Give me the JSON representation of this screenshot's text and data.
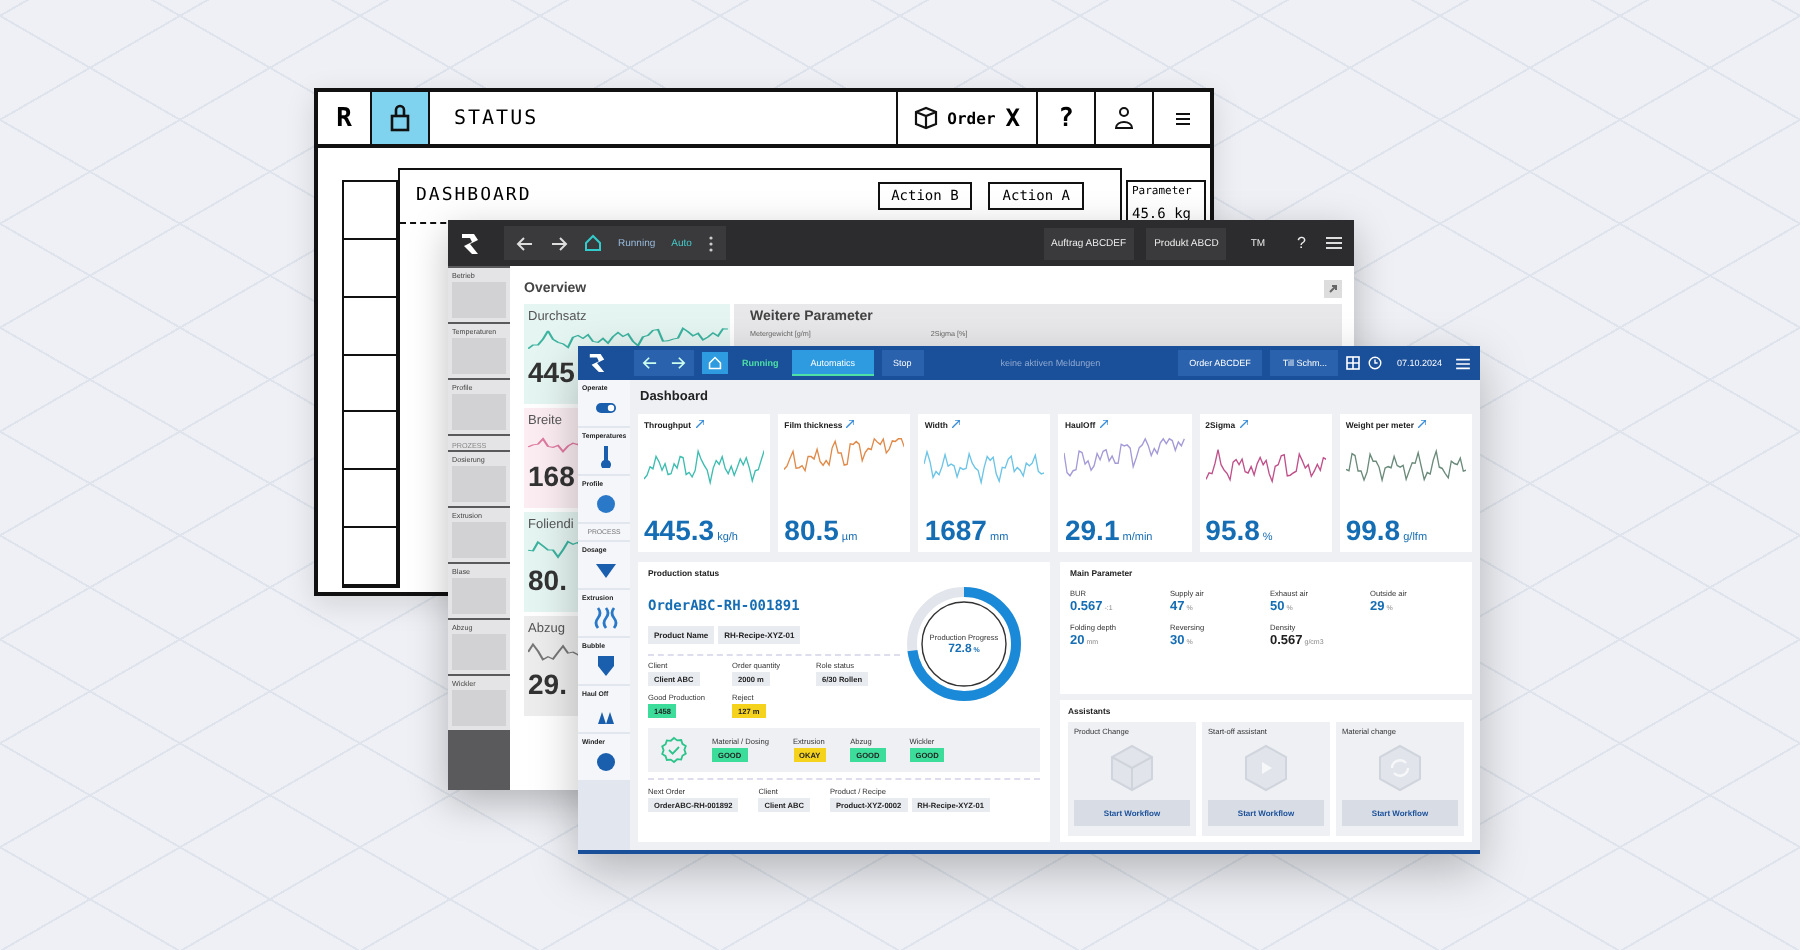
{
  "sketch": {
    "logo": "R",
    "title": "STATUS",
    "order": "Order",
    "close": "X",
    "help": "?",
    "section_title": "DASHBOARD",
    "actions": [
      "Action B",
      "Action A"
    ],
    "param_label": "Parameter",
    "param_value": "45.6 kg"
  },
  "dark": {
    "status": "Running",
    "mode": "Auto",
    "order": "Auftrag ABCDEF",
    "product": "Produkt ABCD",
    "user": "TM",
    "help": "?",
    "sidebar": [
      {
        "kind": "item",
        "label": "Betrieb"
      },
      {
        "kind": "item",
        "label": "Temperaturen"
      },
      {
        "kind": "item",
        "label": "Profile"
      },
      {
        "kind": "header",
        "label": "PROZESS"
      },
      {
        "kind": "item",
        "label": "Dosierung"
      },
      {
        "kind": "item",
        "label": "Extrusion"
      },
      {
        "kind": "item",
        "label": "Blase"
      },
      {
        "kind": "item",
        "label": "Abzug"
      },
      {
        "kind": "item",
        "label": "Wickler"
      }
    ],
    "title": "Overview",
    "cards": [
      {
        "label": "Durchsatz",
        "value": "445",
        "color": "#3cb4a0"
      },
      {
        "label": "Breite",
        "value": "168",
        "color": "#e07aa0"
      },
      {
        "label": "Foliendi",
        "value": "80.",
        "color": "#3cb4a0"
      },
      {
        "label": "Abzug",
        "value": "29.",
        "color": "#777777"
      }
    ],
    "panel_title": "Weitere Parameter",
    "panel_fields": [
      "Metergewicht [g/m]",
      "2Sigma [%]"
    ]
  },
  "front": {
    "status": "Running",
    "modes": [
      {
        "label": "Automatics",
        "selected": true
      },
      {
        "label": "Stop",
        "selected": false
      }
    ],
    "message": "keine aktiven Meldungen",
    "order": "Order ABCDEF",
    "user": "Till Schm...",
    "date": "07.10.2024",
    "sidebar": [
      {
        "kind": "item",
        "label": "Operate"
      },
      {
        "kind": "item",
        "label": "Temperatures"
      },
      {
        "kind": "item",
        "label": "Profile"
      },
      {
        "kind": "header",
        "label": "PROCESS"
      },
      {
        "kind": "item",
        "label": "Dosage"
      },
      {
        "kind": "item",
        "label": "Extrusion"
      },
      {
        "kind": "item",
        "label": "Bubble"
      },
      {
        "kind": "item",
        "label": "Haul Off"
      },
      {
        "kind": "item",
        "label": "Winder"
      }
    ],
    "title": "Dashboard",
    "kpis": [
      {
        "label": "Throughput",
        "value": "445.3",
        "unit": "kg/h",
        "color": "#3dbdb0"
      },
      {
        "label": "Film thickness",
        "value": "80.5",
        "unit": "µm",
        "color": "#e08a4a"
      },
      {
        "label": "Width",
        "value": "1687",
        "unit": "mm",
        "color": "#6cc4e6"
      },
      {
        "label": "HaulOff",
        "value": "29.1",
        "unit": "m/min",
        "color": "#a49ad8"
      },
      {
        "label": "2Sigma",
        "value": "95.8",
        "unit": "%",
        "color": "#c0508a"
      },
      {
        "label": "Weight per meter",
        "value": "99.8",
        "unit": "g/lfm",
        "color": "#6a8a7a"
      }
    ],
    "production": {
      "title": "Production status",
      "order": "OrderABC-RH-001891",
      "chips": [
        "Product Name",
        "RH-Recipe-XYZ-01"
      ],
      "fields": [
        {
          "label": "Client",
          "value": "Client ABC",
          "kind": "neutral"
        },
        {
          "label": "Order quantity",
          "value": "2000 m",
          "kind": "neutral"
        },
        {
          "label": "Role status",
          "value": "6/30 Rollen",
          "kind": "neutral"
        },
        {
          "label": "Good Production",
          "value": "1458",
          "kind": "good"
        },
        {
          "label": "Reject",
          "value": "127 m",
          "kind": "warn"
        }
      ],
      "checks": [
        {
          "label": "Material / Dosing",
          "value": "GOOD",
          "kind": "good"
        },
        {
          "label": "Extrusion",
          "value": "OKAY",
          "kind": "warn"
        },
        {
          "label": "Abzug",
          "value": "GOOD",
          "kind": "good"
        },
        {
          "label": "Wickler",
          "value": "GOOD",
          "kind": "good"
        }
      ],
      "next": [
        {
          "label": "Next Order",
          "values": [
            "OrderABC-RH-001892"
          ]
        },
        {
          "label": "Client",
          "values": [
            "Client ABC"
          ]
        },
        {
          "label": "Product / Recipe",
          "values": [
            "Product-XYZ-0002",
            "RH-Recipe-XYZ-01"
          ]
        }
      ],
      "progress": {
        "label": "Production Progress",
        "value": "72.8",
        "unit": "%",
        "level": 0.728
      }
    },
    "main": {
      "title": "Main Parameter",
      "items": [
        {
          "label": "BUR",
          "value": "0.567",
          "unit": "-:1",
          "highlight": true
        },
        {
          "label": "Supply air",
          "value": "47",
          "unit": "%",
          "highlight": true
        },
        {
          "label": "Exhaust air",
          "value": "50",
          "unit": "%",
          "highlight": true
        },
        {
          "label": "Outside air",
          "value": "29",
          "unit": "%",
          "highlight": true
        },
        {
          "label": "Folding depth",
          "value": "20",
          "unit": "mm",
          "highlight": true
        },
        {
          "label": "Reversing",
          "value": "30",
          "unit": "%",
          "highlight": true
        },
        {
          "label": "Density",
          "value": "0.567",
          "unit": "g/cm3",
          "highlight": false
        }
      ]
    },
    "assistants": {
      "title": "Assistants",
      "items": [
        {
          "title": "Product Change",
          "button": "Start Workflow"
        },
        {
          "title": "Start-off assistant",
          "button": "Start Workflow"
        },
        {
          "title": "Material change",
          "button": "Start Workflow"
        }
      ]
    }
  }
}
